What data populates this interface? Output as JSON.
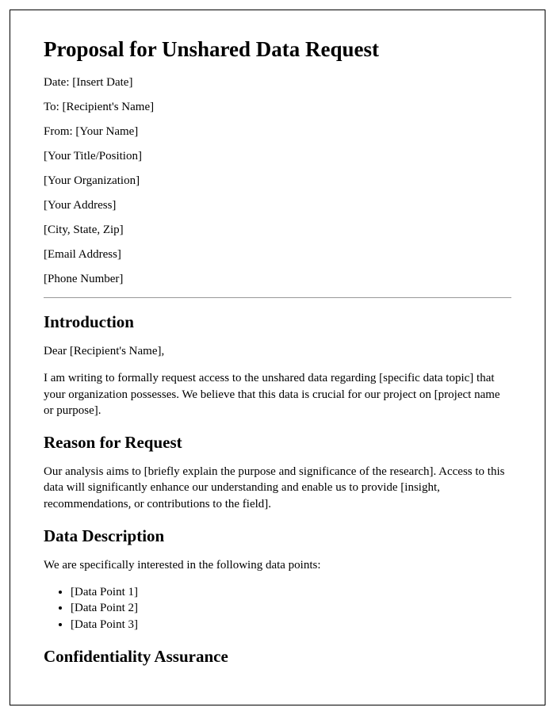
{
  "title": "Proposal for Unshared Data Request",
  "header": {
    "date": "Date: [Insert Date]",
    "to": "To: [Recipient's Name]",
    "from": "From: [Your Name]",
    "title_position": "[Your Title/Position]",
    "organization": "[Your Organization]",
    "address": "[Your Address]",
    "city_state_zip": "[City, State, Zip]",
    "email": "[Email Address]",
    "phone": "[Phone Number]"
  },
  "sections": {
    "introduction": {
      "heading": "Introduction",
      "salutation": "Dear [Recipient's Name],",
      "body": "I am writing to formally request access to the unshared data regarding [specific data topic] that your organization possesses. We believe that this data is crucial for our project on [project name or purpose]."
    },
    "reason": {
      "heading": "Reason for Request",
      "body": "Our analysis aims to [briefly explain the purpose and significance of the research]. Access to this data will significantly enhance our understanding and enable us to provide [insight, recommendations, or contributions to the field]."
    },
    "data_description": {
      "heading": "Data Description",
      "intro": "We are specifically interested in the following data points:",
      "points": [
        "[Data Point 1]",
        "[Data Point 2]",
        "[Data Point 3]"
      ]
    },
    "confidentiality": {
      "heading": "Confidentiality Assurance"
    }
  }
}
